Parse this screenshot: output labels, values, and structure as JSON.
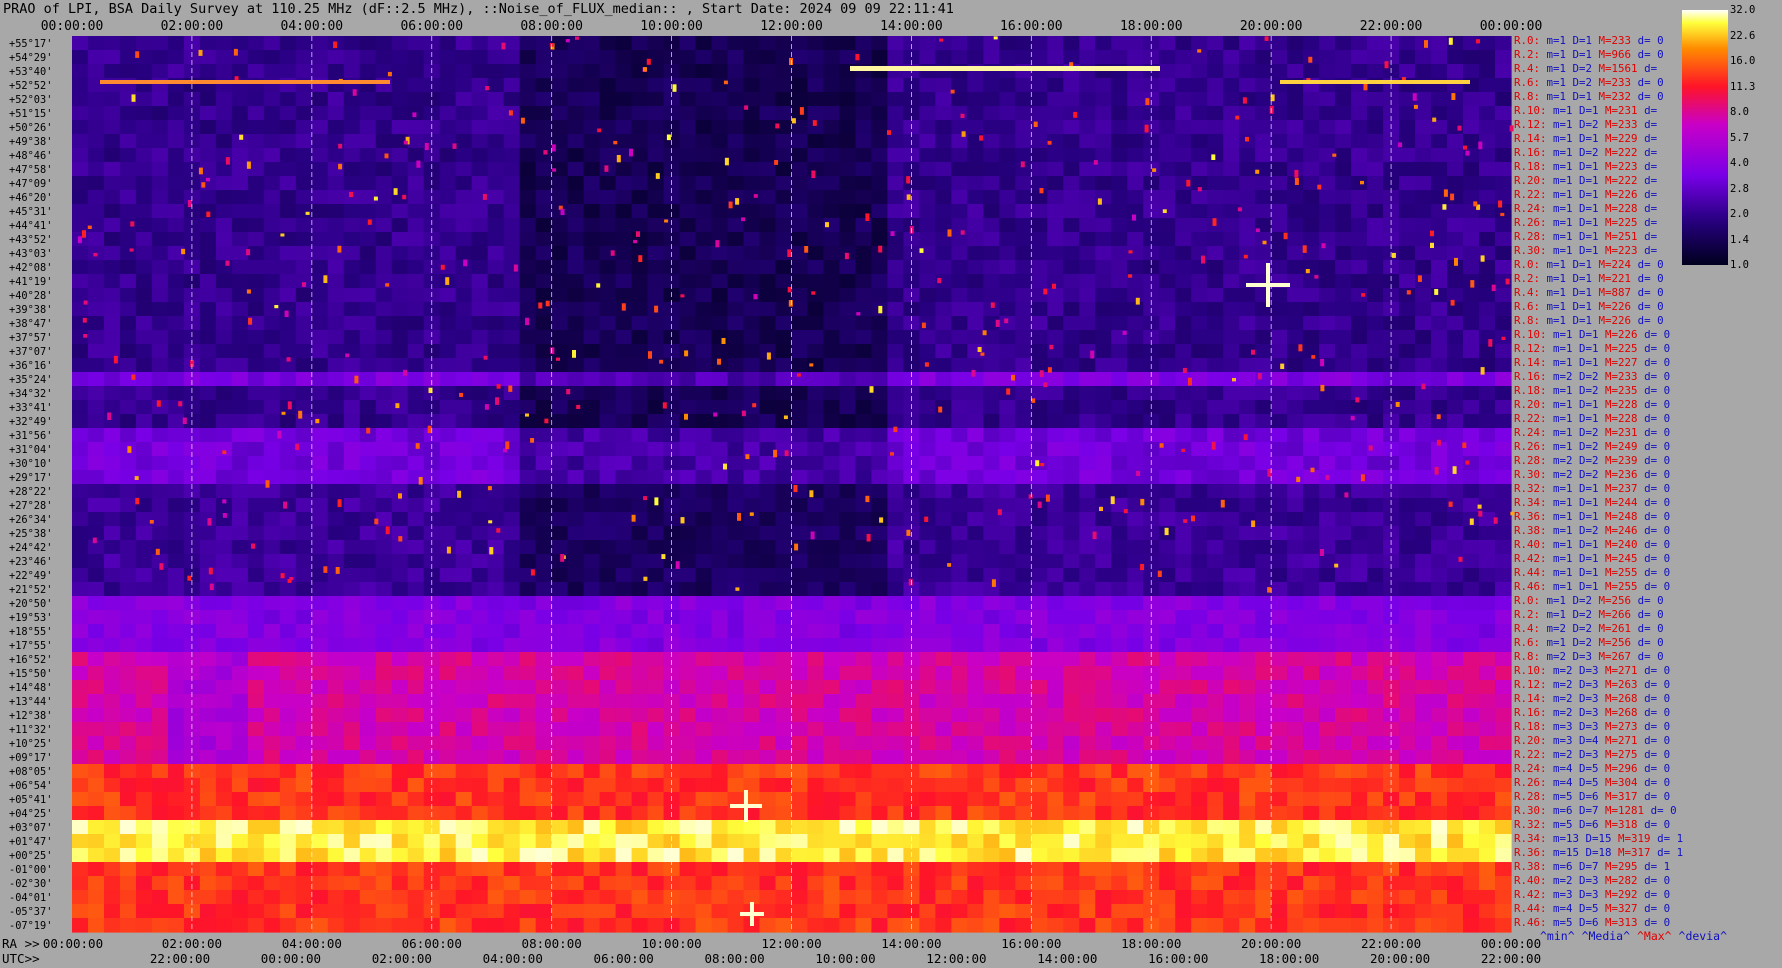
{
  "title": "PRAO of LPI, BSA Daily Survey at 110.25 MHz (dF::2.5 MHz), ::Noise_of_FLUX_median:: , Start Date: 2024 09 09 22:11:41",
  "chart_data": {
    "type": "heatmap",
    "title": "PRAO of LPI, BSA Daily Survey at 110.25 MHz (dF::2.5 MHz), ::Noise_of_FLUX_median:: , Start Date: 2024 09 09 22:11:41",
    "top_axis_ticks": [
      "00:00:00",
      "02:00:00",
      "04:00:00",
      "06:00:00",
      "08:00:00",
      "10:00:00",
      "12:00:00",
      "14:00:00",
      "16:00:00",
      "18:00:00",
      "20:00:00",
      "22:00:00",
      "00:00:00"
    ],
    "bottom_ra_label": "RA >>",
    "bottom_ra_ticks": [
      "00:00:00",
      "02:00:00",
      "04:00:00",
      "06:00:00",
      "08:00:00",
      "10:00:00",
      "12:00:00",
      "14:00:00",
      "16:00:00",
      "18:00:00",
      "20:00:00",
      "22:00:00",
      "00:00:00"
    ],
    "bottom_utc_label": "UTC>>",
    "bottom_utc_ticks": [
      "22:00:00",
      "00:00:00",
      "02:00:00",
      "04:00:00",
      "06:00:00",
      "08:00:00",
      "10:00:00",
      "12:00:00",
      "14:00:00",
      "16:00:00",
      "18:00:00",
      "20:00:00",
      "22:00:00"
    ],
    "y_labels": [
      "+55°17'",
      "+54°29'",
      "+53°40'",
      "+52°52'",
      "+52°03'",
      "+51°15'",
      "+50°26'",
      "+49°38'",
      "+48°46'",
      "+47°58'",
      "+47°09'",
      "+46°20'",
      "+45°31'",
      "+44°41'",
      "+43°52'",
      "+43°03'",
      "+42°08'",
      "+41°19'",
      "+40°28'",
      "+39°38'",
      "+38°47'",
      "+37°57'",
      "+37°07'",
      "+36°16'",
      "+35°24'",
      "+34°32'",
      "+33°41'",
      "+32°49'",
      "+31°56'",
      "+31°04'",
      "+30°10'",
      "+29°17'",
      "+28°22'",
      "+27°28'",
      "+26°34'",
      "+25°38'",
      "+24°42'",
      "+23°46'",
      "+22°49'",
      "+21°52'",
      "+20°50'",
      "+19°53'",
      "+18°55'",
      "+17°55'",
      "+16°52'",
      "+15°50'",
      "+14°48'",
      "+13°44'",
      "+12°38'",
      "+11°32'",
      "+10°25'",
      "+09°17'",
      "+08°05'",
      "+06°54'",
      "+05°41'",
      "+04°25'",
      "+03°07'",
      "+01°47'",
      "+00°25'",
      "-01°00'",
      "-02°30'",
      "-04°01'",
      "-05°37'",
      "-07°19'"
    ],
    "colorbar": {
      "ticks": [
        "32.0",
        "22.6",
        "16.0",
        "11.3",
        "8.0",
        "5.7",
        "4.0",
        "2.8",
        "2.0",
        "1.4",
        "1.0"
      ],
      "scale": "log"
    },
    "colors": {
      "low": "#000033",
      "mid": "#7a00e0",
      "high": "#ff2020",
      "peak": "#ffffa0"
    },
    "row_stats": [
      {
        "ra": "R.0:",
        "m": "m=1",
        "D": "D=1",
        "M": "M=233",
        "d": "d= 0"
      },
      {
        "ra": "R.2:",
        "m": "m=1",
        "D": "D=1",
        "M": "M=966",
        "d": "d= 0"
      },
      {
        "ra": "R.4:",
        "m": "m=1",
        "D": "D=2",
        "M": "M=1561",
        "d": "d="
      },
      {
        "ra": "R.6:",
        "m": "m=1",
        "D": "D=2",
        "M": "M=233",
        "d": "d= 0"
      },
      {
        "ra": "R.8:",
        "m": "m=1",
        "D": "D=1",
        "M": "M=232",
        "d": "d= 0"
      },
      {
        "ra": "R.10:",
        "m": "m=1",
        "D": "D=1",
        "M": "M=231",
        "d": "d="
      },
      {
        "ra": "R.12:",
        "m": "m=1",
        "D": "D=2",
        "M": "M=233",
        "d": "d="
      },
      {
        "ra": "R.14:",
        "m": "m=1",
        "D": "D=1",
        "M": "M=229",
        "d": "d="
      },
      {
        "ra": "R.16:",
        "m": "m=1",
        "D": "D=2",
        "M": "M=222",
        "d": "d="
      },
      {
        "ra": "R.18:",
        "m": "m=1",
        "D": "D=1",
        "M": "M=223",
        "d": "d="
      },
      {
        "ra": "R.20:",
        "m": "m=1",
        "D": "D=1",
        "M": "M=222",
        "d": "d="
      },
      {
        "ra": "R.22:",
        "m": "m=1",
        "D": "D=1",
        "M": "M=226",
        "d": "d="
      },
      {
        "ra": "R.24:",
        "m": "m=1",
        "D": "D=1",
        "M": "M=228",
        "d": "d="
      },
      {
        "ra": "R.26:",
        "m": "m=1",
        "D": "D=1",
        "M": "M=225",
        "d": "d="
      },
      {
        "ra": "R.28:",
        "m": "m=1",
        "D": "D=1",
        "M": "M=251",
        "d": "d="
      },
      {
        "ra": "R.30:",
        "m": "m=1",
        "D": "D=1",
        "M": "M=223",
        "d": "d="
      },
      {
        "ra": "R.0:",
        "m": "m=1",
        "D": "D=1",
        "M": "M=224",
        "d": "d= 0"
      },
      {
        "ra": "R.2:",
        "m": "m=1",
        "D": "D=1",
        "M": "M=221",
        "d": "d= 0"
      },
      {
        "ra": "R.4:",
        "m": "m=1",
        "D": "D=1",
        "M": "M=887",
        "d": "d= 0"
      },
      {
        "ra": "R.6:",
        "m": "m=1",
        "D": "D=1",
        "M": "M=226",
        "d": "d= 0"
      },
      {
        "ra": "R.8:",
        "m": "m=1",
        "D": "D=1",
        "M": "M=226",
        "d": "d= 0"
      },
      {
        "ra": "R.10:",
        "m": "m=1",
        "D": "D=1",
        "M": "M=226",
        "d": "d= 0"
      },
      {
        "ra": "R.12:",
        "m": "m=1",
        "D": "D=1",
        "M": "M=225",
        "d": "d= 0"
      },
      {
        "ra": "R.14:",
        "m": "m=1",
        "D": "D=1",
        "M": "M=227",
        "d": "d= 0"
      },
      {
        "ra": "R.16:",
        "m": "m=2",
        "D": "D=2",
        "M": "M=233",
        "d": "d= 0"
      },
      {
        "ra": "R.18:",
        "m": "m=1",
        "D": "D=2",
        "M": "M=235",
        "d": "d= 0"
      },
      {
        "ra": "R.20:",
        "m": "m=1",
        "D": "D=1",
        "M": "M=228",
        "d": "d= 0"
      },
      {
        "ra": "R.22:",
        "m": "m=1",
        "D": "D=1",
        "M": "M=228",
        "d": "d= 0"
      },
      {
        "ra": "R.24:",
        "m": "m=1",
        "D": "D=2",
        "M": "M=231",
        "d": "d= 0"
      },
      {
        "ra": "R.26:",
        "m": "m=1",
        "D": "D=2",
        "M": "M=249",
        "d": "d= 0"
      },
      {
        "ra": "R.28:",
        "m": "m=2",
        "D": "D=2",
        "M": "M=239",
        "d": "d= 0"
      },
      {
        "ra": "R.30:",
        "m": "m=2",
        "D": "D=2",
        "M": "M=236",
        "d": "d= 0"
      },
      {
        "ra": "R.32:",
        "m": "m=1",
        "D": "D=1",
        "M": "M=237",
        "d": "d= 0"
      },
      {
        "ra": "R.34:",
        "m": "m=1",
        "D": "D=1",
        "M": "M=244",
        "d": "d= 0"
      },
      {
        "ra": "R.36:",
        "m": "m=1",
        "D": "D=1",
        "M": "M=248",
        "d": "d= 0"
      },
      {
        "ra": "R.38:",
        "m": "m=1",
        "D": "D=2",
        "M": "M=246",
        "d": "d= 0"
      },
      {
        "ra": "R.40:",
        "m": "m=1",
        "D": "D=1",
        "M": "M=240",
        "d": "d= 0"
      },
      {
        "ra": "R.42:",
        "m": "m=1",
        "D": "D=1",
        "M": "M=245",
        "d": "d= 0"
      },
      {
        "ra": "R.44:",
        "m": "m=1",
        "D": "D=1",
        "M": "M=255",
        "d": "d= 0"
      },
      {
        "ra": "R.46:",
        "m": "m=1",
        "D": "D=1",
        "M": "M=255",
        "d": "d= 0"
      },
      {
        "ra": "R.0:",
        "m": "m=1",
        "D": "D=2",
        "M": "M=256",
        "d": "d= 0"
      },
      {
        "ra": "R.2:",
        "m": "m=1",
        "D": "D=2",
        "M": "M=266",
        "d": "d= 0"
      },
      {
        "ra": "R.4:",
        "m": "m=2",
        "D": "D=2",
        "M": "M=261",
        "d": "d= 0"
      },
      {
        "ra": "R.6:",
        "m": "m=1",
        "D": "D=2",
        "M": "M=256",
        "d": "d= 0"
      },
      {
        "ra": "R.8:",
        "m": "m=2",
        "D": "D=3",
        "M": "M=267",
        "d": "d= 0"
      },
      {
        "ra": "R.10:",
        "m": "m=2",
        "D": "D=3",
        "M": "M=271",
        "d": "d= 0"
      },
      {
        "ra": "R.12:",
        "m": "m=2",
        "D": "D=3",
        "M": "M=263",
        "d": "d= 0"
      },
      {
        "ra": "R.14:",
        "m": "m=2",
        "D": "D=3",
        "M": "M=268",
        "d": "d= 0"
      },
      {
        "ra": "R.16:",
        "m": "m=2",
        "D": "D=3",
        "M": "M=268",
        "d": "d= 0"
      },
      {
        "ra": "R.18:",
        "m": "m=3",
        "D": "D=3",
        "M": "M=273",
        "d": "d= 0"
      },
      {
        "ra": "R.20:",
        "m": "m=3",
        "D": "D=4",
        "M": "M=271",
        "d": "d= 0"
      },
      {
        "ra": "R.22:",
        "m": "m=2",
        "D": "D=3",
        "M": "M=275",
        "d": "d= 0"
      },
      {
        "ra": "R.24:",
        "m": "m=4",
        "D": "D=5",
        "M": "M=296",
        "d": "d= 0"
      },
      {
        "ra": "R.26:",
        "m": "m=4",
        "D": "D=5",
        "M": "M=304",
        "d": "d= 0"
      },
      {
        "ra": "R.28:",
        "m": "m=5",
        "D": "D=6",
        "M": "M=317",
        "d": "d= 0"
      },
      {
        "ra": "R.30:",
        "m": "m=6",
        "D": "D=7",
        "M": "M=1281",
        "d": "d= 0"
      },
      {
        "ra": "R.32:",
        "m": "m=5",
        "D": "D=6",
        "M": "M=318",
        "d": "d= 0"
      },
      {
        "ra": "R.34:",
        "m": "m=13",
        "D": "D=15",
        "M": "M=319",
        "d": "d= 1"
      },
      {
        "ra": "R.36:",
        "m": "m=15",
        "D": "D=18",
        "M": "M=317",
        "d": "d= 1"
      },
      {
        "ra": "R.38:",
        "m": "m=6",
        "D": "D=7",
        "M": "M=295",
        "d": "d= 1"
      },
      {
        "ra": "R.40:",
        "m": "m=2",
        "D": "D=3",
        "M": "M=282",
        "d": "d= 0"
      },
      {
        "ra": "R.42:",
        "m": "m=3",
        "D": "D=3",
        "M": "M=292",
        "d": "d= 0"
      },
      {
        "ra": "R.44:",
        "m": "m=4",
        "D": "D=5",
        "M": "M=327",
        "d": "d= 0"
      },
      {
        "ra": "R.46:",
        "m": "m=5",
        "D": "D=6",
        "M": "M=313",
        "d": "d= 0"
      }
    ],
    "legend_footer": [
      "^min^",
      "^Media^",
      "^Max^",
      "^devia^"
    ]
  }
}
